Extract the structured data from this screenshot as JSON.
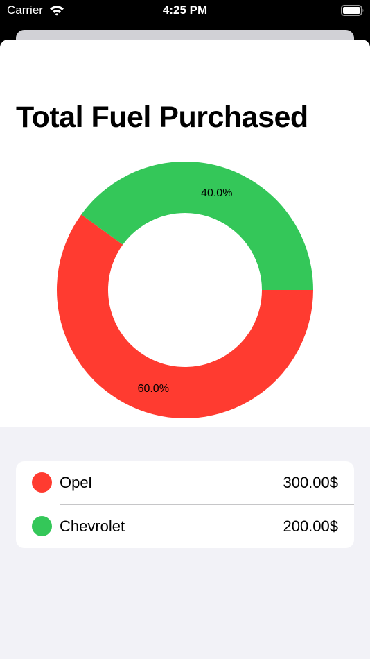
{
  "status_bar": {
    "carrier": "Carrier",
    "time": "4:25 PM"
  },
  "icons": {
    "wifi": "wifi-icon",
    "battery": "battery-icon"
  },
  "colors": {
    "opel": "#ff3b30",
    "chevrolet": "#34c759",
    "background": "#f2f2f7"
  },
  "page": {
    "title": "Total Fuel Purchased"
  },
  "chart_data": {
    "type": "pie",
    "style": "donut",
    "title": "Total Fuel Purchased",
    "categories": [
      "Opel",
      "Chevrolet"
    ],
    "values": [
      300,
      200
    ],
    "labels": [
      "60.0%",
      "40.0%"
    ],
    "colors": [
      "#ff3b30",
      "#34c759"
    ],
    "legend": "none"
  },
  "list": {
    "rows": [
      {
        "name": "Opel",
        "value": "300.00$",
        "color": "#ff3b30"
      },
      {
        "name": "Chevrolet",
        "value": "200.00$",
        "color": "#34c759"
      }
    ]
  }
}
